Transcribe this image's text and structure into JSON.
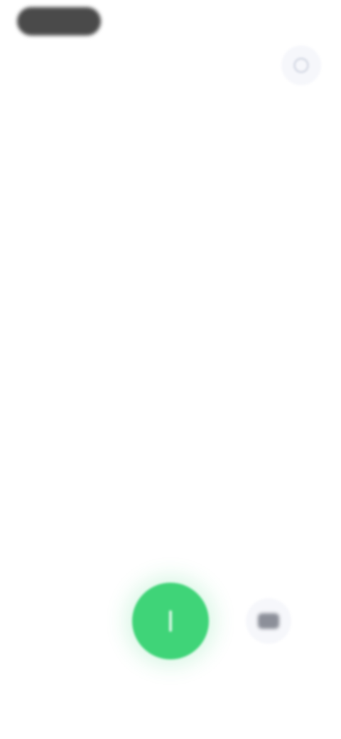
{
  "app": {
    "title": ""
  },
  "top_pill": {
    "label": "",
    "icon": "status-pill"
  },
  "settings": {
    "icon": "gear-icon",
    "aria_label": ""
  },
  "main": {
    "headline": "",
    "description": ""
  },
  "controls": {
    "primary": {
      "icon": "microphone-icon",
      "label": ""
    },
    "secondary": {
      "icon": "keyboard-icon",
      "label": ""
    }
  },
  "colors": {
    "accent_green": "#3fd478",
    "headline_green": "#4fd383",
    "body_text_gray": "#8e8e8e",
    "button_bg_light": "#f6f7fb",
    "pill_dark": "#4a4a4a",
    "background": "#ffffff"
  }
}
